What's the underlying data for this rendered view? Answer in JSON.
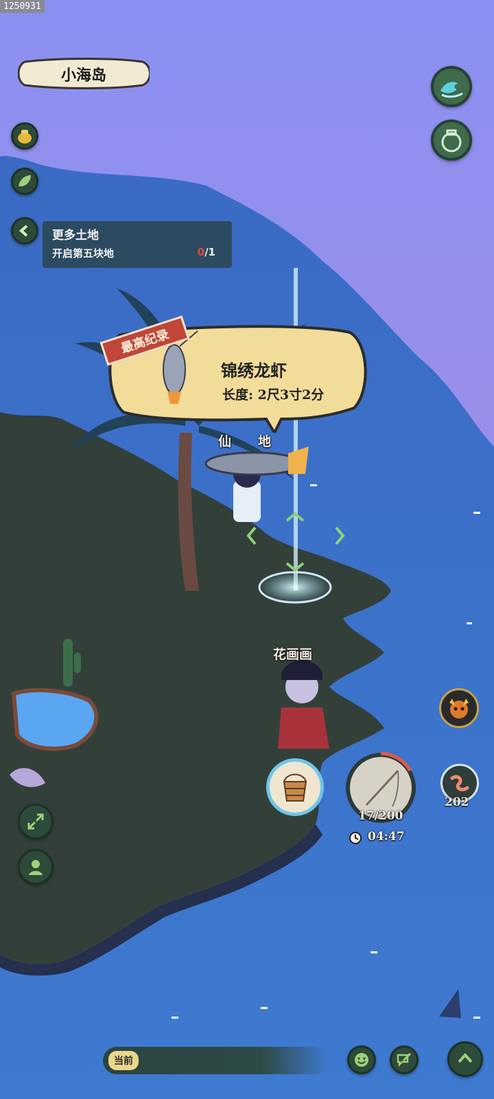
{
  "watermark": "1250931",
  "location_title": "小海岛",
  "quest": {
    "title": "更多土地",
    "desc": "开启第五块地",
    "progress_current": "0",
    "progress_total": "/1"
  },
  "record_popup": {
    "badge": "最高纪录",
    "fish_name": "锦绣龙虾",
    "length": "长度: 2尺3寸2分"
  },
  "characters": {
    "player_name": "仙",
    "player_name_tail": "地",
    "npc_name": "花画画"
  },
  "fishing": {
    "catch_count": "17/200",
    "timer": "04:47",
    "bait_count": "202"
  },
  "chat": {
    "channel_label": "当前"
  },
  "icons": {
    "top_right_1": "wave-icon",
    "top_right_2": "jar-icon",
    "left_1": "gold-pot-icon",
    "left_2": "leaf-icon",
    "quest_toggle": "chevron-left-icon",
    "expand": "expand-arrows-icon",
    "profile": "person-icon",
    "boss": "demon-face-icon",
    "bait": "worm-icon",
    "bucket": "bucket-icon",
    "rod": "fishing-rod-icon",
    "clock": "clock-icon",
    "emoji": "smile-icon",
    "quick_chat": "chat-edit-icon",
    "up": "chevron-up-icon"
  },
  "colors": {
    "sky": "#8a8ef0",
    "sea": "#3c74c8",
    "land": "#33403a",
    "quest_red": "#e24a3a",
    "record_red": "#c0463a"
  }
}
